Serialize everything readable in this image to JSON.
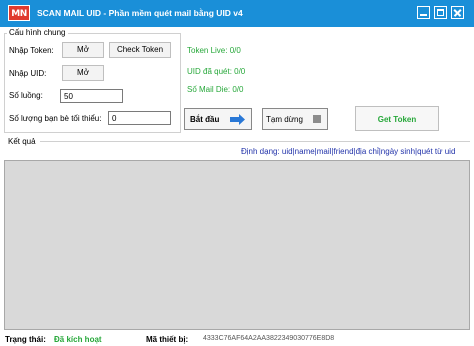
{
  "app": {
    "logo_text": "MN",
    "title": "SCAN MAIL UID - Phần mềm quét mail bằng UID v4"
  },
  "config": {
    "group_title": "Cấu hình chung",
    "import_token_label": "Nhập Token:",
    "open_button_1": "Mở",
    "check_token_button": "Check Token",
    "import_uid_label": "Nhập UID:",
    "open_button_2": "Mở",
    "thread_count_label": "Số luồng:",
    "thread_count_value": "50",
    "min_friends_label": "Số lượng bạn bè tối thiểu:",
    "min_friends_value": "0"
  },
  "stats": {
    "token_live": "Token Live: 0/0",
    "uid_scanned": "UID đã quét: 0/0",
    "mail_die": "Số Mail Die: 0/0"
  },
  "actions": {
    "start_label": "Bắt đầu",
    "pause_label": "Tạm dừng",
    "get_token_label": "Get Token"
  },
  "results": {
    "group_title": "Kết quả",
    "format_hint": "Định dạng: uid|name|mail|friend|địa chỉ|ngày sinh|quét từ uid"
  },
  "status": {
    "state_label": "Trạng thái:",
    "state_value": "Đã kích hoạt",
    "device_label": "Mã thiết bị:",
    "device_value": "4333C76AF64A2AA3822349030776E8D8"
  },
  "colors": {
    "titlebar": "#1a8fd8",
    "logo": "#e03a2f",
    "green_text": "#27a83a",
    "results_bg": "#d9d9d9"
  }
}
